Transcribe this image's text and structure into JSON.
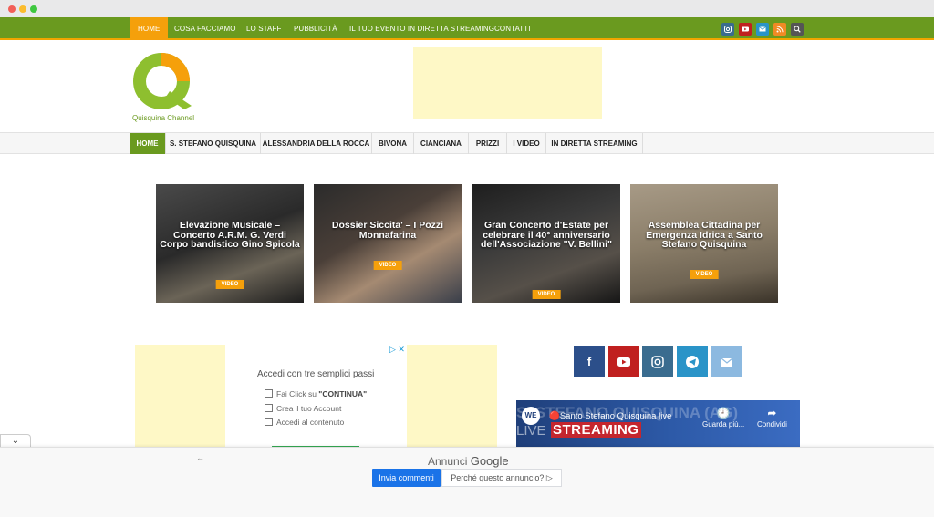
{
  "topnav": {
    "items": [
      "HOME",
      "COSA FACCIAMO",
      "LO STAFF",
      "PUBBLICITÀ",
      "IL TUO EVENTO IN DIRETTA STREAMING",
      "CONTATTI"
    ],
    "social_icons": [
      "instagram-icon",
      "youtube-icon",
      "mail-icon",
      "rss-icon",
      "search-icon"
    ]
  },
  "logo": {
    "caption": "Quisquina Channel"
  },
  "catnav": {
    "items": [
      "HOME",
      "S. STEFANO QUISQUINA",
      "ALESSANDRIA DELLA ROCCA",
      "BIVONA",
      "CIANCIANA",
      "PRIZZI",
      "I VIDEO",
      "IN DIRETTA STREAMING"
    ]
  },
  "cards": [
    {
      "title": "Elevazione Musicale – Concerto A.R.M. G. Verdi Corpo bandistico Gino Spicola",
      "badge": "VIDEO"
    },
    {
      "title": "Dossier Siccita' – I Pozzi Monnafarina",
      "badge": "VIDEO"
    },
    {
      "title": "Gran Concerto d'Estate per celebrare il 40° anniversario dell'Associazione \"V. Bellini\"",
      "badge": "VIDEO"
    },
    {
      "title": "Assemblea Cittadina per Emergenza Idrica a Santo Stefano Quisquina",
      "badge": "VIDEO"
    }
  ],
  "ad_box": {
    "heading": "Accedi con tre semplici passi",
    "step1_prefix": "Fai Click su ",
    "step1_bold": "\"CONTINUA\"",
    "step2": "Crea il tuo Account",
    "step3": "Accedi al contenuto"
  },
  "social": {
    "icons": [
      "facebook-icon",
      "youtube-icon",
      "instagram-icon",
      "telegram-icon",
      "mail-icon"
    ],
    "colors": [
      "#2c4f8a",
      "#c0201f",
      "#3a6c8f",
      "#2a94c8",
      "#8cb9e0"
    ]
  },
  "player": {
    "bg_text": "S. STEFANO QUISQUINA (AG)",
    "live": "LIVE",
    "streaming": "STREAMING",
    "avatar": "WE",
    "title": "🔴Santo Stefano Quisquina live",
    "watch_later": "Guarda più...",
    "share": "Condividi"
  },
  "adbar": {
    "annunci": "Annunci",
    "google": "Google",
    "send_feedback": "Invia commenti",
    "why": "Perché questo annuncio? ▷"
  }
}
